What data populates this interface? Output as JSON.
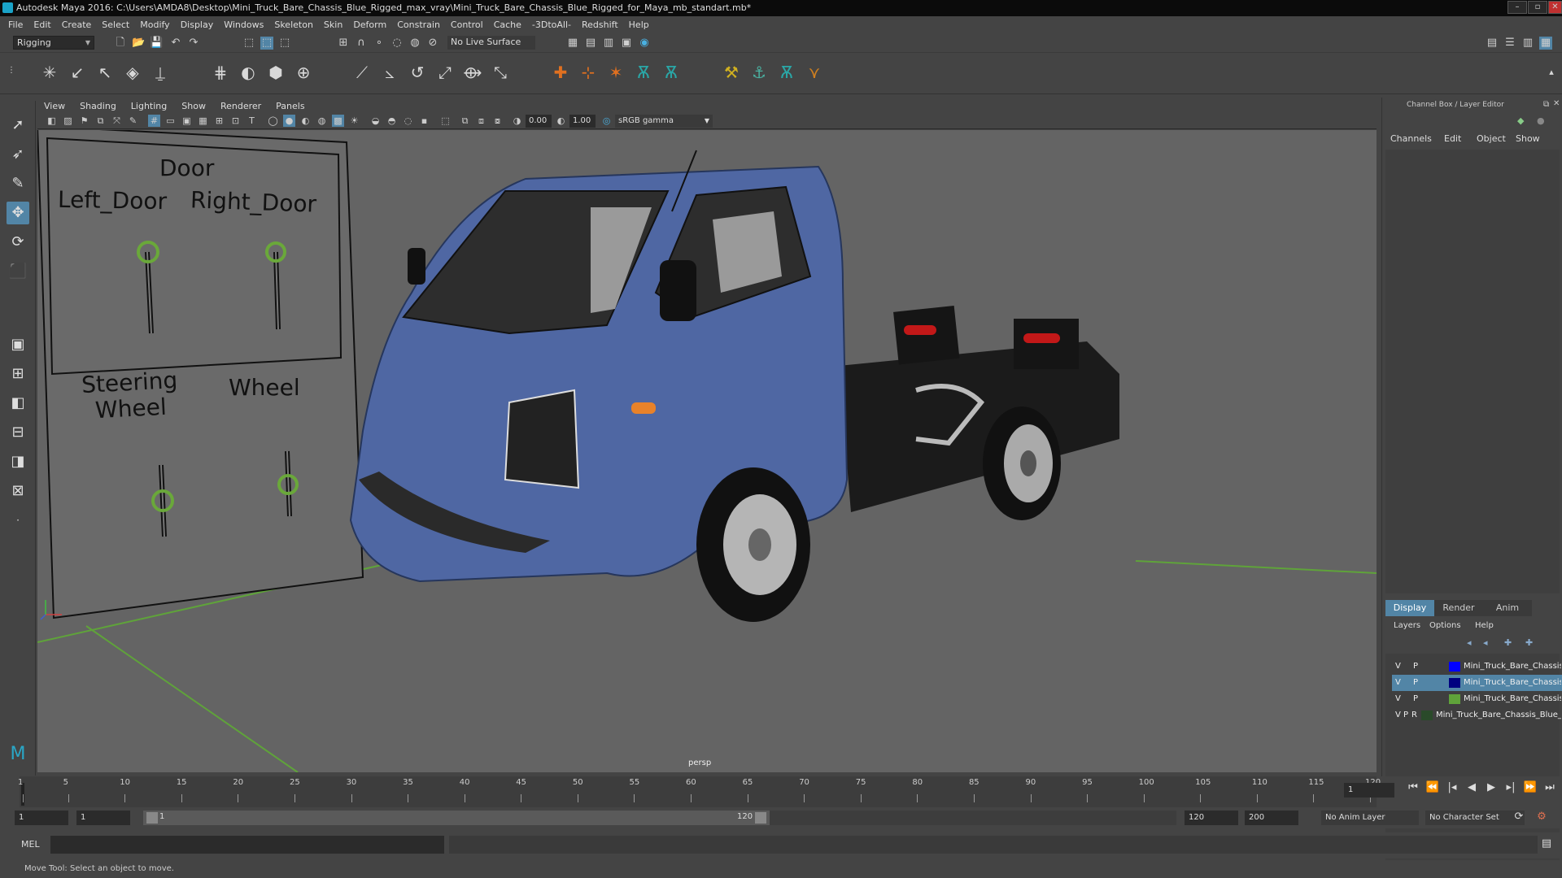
{
  "window": {
    "title": "Autodesk Maya 2016: C:\\Users\\AMDA8\\Desktop\\Mini_Truck_Bare_Chassis_Blue_Rigged_max_vray\\Mini_Truck_Bare_Chassis_Blue_Rigged_for_Maya_mb_standart.mb*"
  },
  "menubar": [
    "File",
    "Edit",
    "Create",
    "Select",
    "Modify",
    "Display",
    "Windows",
    "Skeleton",
    "Skin",
    "Deform",
    "Constrain",
    "Control",
    "Cache",
    "-3DtoAll-",
    "Redshift",
    "Help"
  ],
  "statusline": {
    "menuset": "Rigging",
    "live_surface": "No Live Surface"
  },
  "viewport_menu": [
    "View",
    "Shading",
    "Lighting",
    "Show",
    "Renderer",
    "Panels"
  ],
  "viewport_toolbar": {
    "near": "0.00",
    "far": "1.00",
    "color_space": "sRGB gamma"
  },
  "viewport": {
    "camera": "persp",
    "panel": {
      "door_title": "Door",
      "left_door": "Left_Door",
      "right_door": "Right_Door",
      "steering": "Steering\nWheel",
      "wheel": "Wheel"
    }
  },
  "channel_box": {
    "title": "Channel Box / Layer Editor",
    "menu": [
      "Channels",
      "Edit",
      "Object",
      "Show"
    ],
    "tabs": [
      "Display",
      "Render",
      "Anim"
    ],
    "layer_menu": [
      "Layers",
      "Options",
      "Help"
    ],
    "layers": [
      {
        "v": "V",
        "p": "P",
        "r": "",
        "color": "#0000ff",
        "name": "Mini_Truck_Bare_Chassis_Blue_Rigged_controllers",
        "selected": false
      },
      {
        "v": "V",
        "p": "P",
        "r": "",
        "color": "#000080",
        "name": "Mini_Truck_Bare_Chassis_Blue_Rigged_helpers",
        "selected": true
      },
      {
        "v": "V",
        "p": "P",
        "r": "",
        "color": "#5fa33a",
        "name": "Mini_Truck_Bare_Chassis_Blue_Rigged_bones",
        "selected": false
      },
      {
        "v": "V",
        "p": "P",
        "r": "R",
        "color": "#2a4a2a",
        "name": "Mini_Truck_Bare_Chassis_Blue_Rigged",
        "selected": false
      }
    ]
  },
  "timeline": {
    "ticks": [
      1,
      5,
      10,
      15,
      20,
      25,
      30,
      35,
      40,
      45,
      50,
      55,
      60,
      65,
      70,
      75,
      80,
      85,
      90,
      95,
      100,
      105,
      110,
      115,
      120
    ],
    "current_frame": "1"
  },
  "range": {
    "start": "1",
    "playback_start": "1",
    "range_start_label": "1",
    "range_end_label": "120",
    "playback_end": "120",
    "end": "200",
    "anim_layer": "No Anim Layer",
    "character_set": "No Character Set"
  },
  "cmdline": {
    "label": "MEL"
  },
  "helpline": {
    "text": "Move Tool: Select an object to move."
  }
}
